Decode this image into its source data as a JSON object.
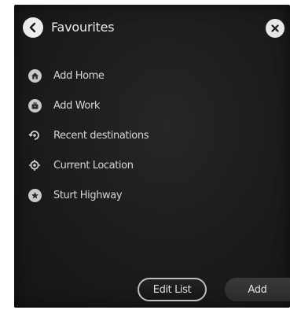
{
  "header": {
    "title": "Favourites",
    "back_icon": "chevron-left-icon",
    "close_icon": "close-icon"
  },
  "items": [
    {
      "label": "Add Home",
      "icon": "home-icon"
    },
    {
      "label": "Add Work",
      "icon": "work-icon"
    },
    {
      "label": "Recent destinations",
      "icon": "recent-destinations-icon"
    },
    {
      "label": "Current Location",
      "icon": "current-location-icon"
    },
    {
      "label": "Sturt Highway",
      "icon": "star-icon"
    }
  ],
  "footer": {
    "edit_label": "Edit List",
    "add_label": "Add"
  },
  "colors": {
    "background": "#1c1c1c",
    "text": "#d6d6d6",
    "icon": "#c9c9c9"
  }
}
